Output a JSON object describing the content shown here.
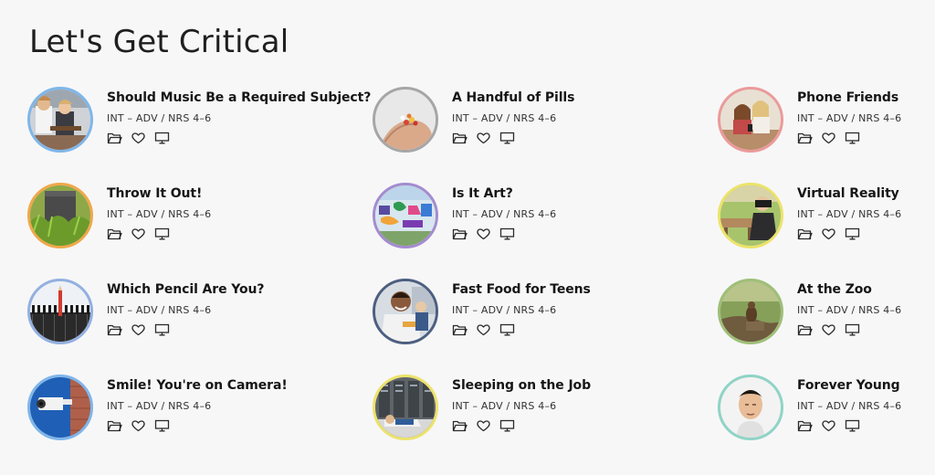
{
  "page": {
    "title": "Let's Get Critical"
  },
  "cards": [
    {
      "title": "Should Music Be a Required Subject?",
      "meta": "INT – ADV / NRS 4–6",
      "ring": "#7fb6ea",
      "image": "music-students"
    },
    {
      "title": "A Handful of Pills",
      "meta": "INT – ADV / NRS 4–6",
      "ring": "#a6a6a6",
      "image": "pills-hand"
    },
    {
      "title": "Phone Friends",
      "meta": "INT – ADV / NRS 4–6",
      "ring": "#ec9a9a",
      "image": "girls-phones"
    },
    {
      "title": "Throw It Out!",
      "meta": "INT – ADV / NRS 4–6",
      "ring": "#f0a84a",
      "image": "overgrown-bin"
    },
    {
      "title": "Is It Art?",
      "meta": "INT – ADV / NRS 4–6",
      "ring": "#a58bd0",
      "image": "graffiti-wall"
    },
    {
      "title": "Virtual Reality",
      "meta": "INT – ADV / NRS 4–6",
      "ring": "#ece36a",
      "image": "vr-headset"
    },
    {
      "title": "Which Pencil Are You?",
      "meta": "INT – ADV / NRS 4–6",
      "ring": "#93b0e0",
      "image": "pencil-row"
    },
    {
      "title": "Fast Food for Teens",
      "meta": "INT – ADV / NRS 4–6",
      "ring": "#4d5f80",
      "image": "teen-eating"
    },
    {
      "title": "At the Zoo",
      "meta": "INT – ADV / NRS 4–6",
      "ring": "#9fbf79",
      "image": "zoo-animal"
    },
    {
      "title": "Smile! You're on Camera!",
      "meta": "INT – ADV / NRS 4–6",
      "ring": "#7fb6ea",
      "image": "security-camera"
    },
    {
      "title": "Sleeping on the Job",
      "meta": "INT – ADV / NRS 4–6",
      "ring": "#ece36a",
      "image": "sleeping-worker"
    },
    {
      "title": "Forever Young",
      "meta": "INT – ADV / NRS 4–6",
      "ring": "#8fd4c6",
      "image": "man-face"
    }
  ],
  "actions": {
    "folder": "folder-icon",
    "favorite": "heart-icon",
    "present": "monitor-icon"
  }
}
